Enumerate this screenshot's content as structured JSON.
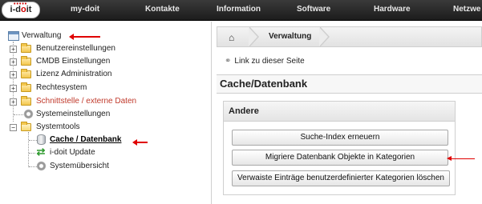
{
  "logo": {
    "text_a": "i-d",
    "text_o": "o",
    "text_b": "it",
    "dots": "•••••"
  },
  "nav": [
    "my-doit",
    "Kontakte",
    "Information",
    "Software",
    "Hardware",
    "Netzwe"
  ],
  "tree": {
    "root": "Verwaltung",
    "items": [
      "Benutzereinstellungen",
      "CMDB Einstellungen",
      "Lizenz Administration",
      "Rechtesystem",
      "Schnittstelle / externe Daten",
      "Systemeinstellungen",
      "Systemtools"
    ],
    "children": [
      "Cache / Datenbank",
      "i-doit Update",
      "Systemübersicht"
    ],
    "expander_plus": "+",
    "expander_minus": "−"
  },
  "breadcrumb": {
    "home_icon": "home-icon",
    "home_glyph": "⌂",
    "current": "Verwaltung"
  },
  "permalink": {
    "icon": "link-icon",
    "glyph": "⚭",
    "label": "Link zu dieser Seite"
  },
  "page_title": "Cache/Datenbank",
  "panel": {
    "title": "Andere",
    "buttons": [
      "Suche-Index erneuern",
      "Migriere Datenbank Objekte in Kategorien",
      "Verwaiste Einträge benutzerdefinierter Kategorien löschen"
    ]
  },
  "colors": {
    "accent_red": "#e00000",
    "highlight_text": "#c0392b",
    "nav_bg": "#2a2a2a"
  }
}
